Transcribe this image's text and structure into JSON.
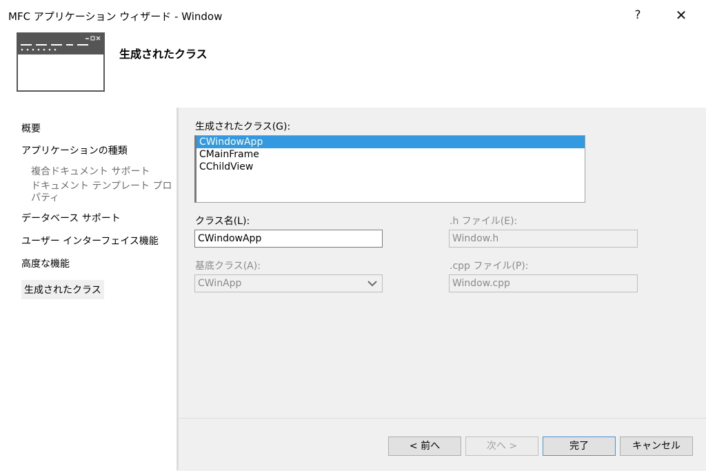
{
  "window": {
    "title": "MFC アプリケーション ウィザード - Window",
    "help_icon": "?",
    "close_icon": "✕"
  },
  "header": {
    "title": "生成されたクラス",
    "icon": "window-layout-icon"
  },
  "nav": {
    "items": [
      {
        "label": "概要"
      },
      {
        "label": "アプリケーションの種類"
      },
      {
        "label": "複合ドキュメント サポート"
      },
      {
        "label": "ドキュメント テンプレート プロパティ"
      },
      {
        "label": "データベース サポート"
      },
      {
        "label": "ユーザー インターフェイス機能"
      },
      {
        "label": "高度な機能"
      },
      {
        "label": "生成されたクラス"
      }
    ]
  },
  "form": {
    "classes_label": "生成されたクラス(G):",
    "classes": [
      "CWindowApp",
      "CMainFrame",
      "CChildView"
    ],
    "selected_class": "CWindowApp",
    "class_name_label": "クラス名(L):",
    "class_name_value": "CWindowApp",
    "h_file_label": ".h ファイル(E):",
    "h_file_value": "Window.h",
    "base_class_label": "基底クラス(A):",
    "base_class_value": "CWinApp",
    "cpp_file_label": ".cpp ファイル(P):",
    "cpp_file_value": "Window.cpp"
  },
  "buttons": {
    "back": "< 前へ",
    "next": "次へ >",
    "finish": "完了",
    "cancel": "キャンセル"
  }
}
